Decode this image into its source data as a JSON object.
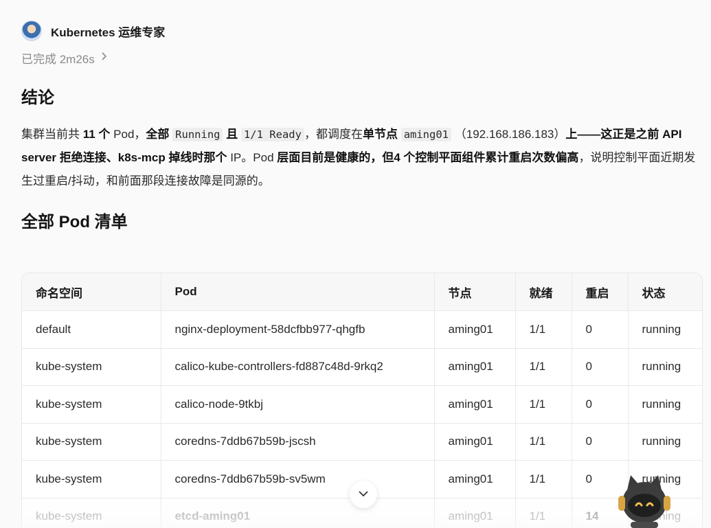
{
  "agent": {
    "name": "Kubernetes 运维专家",
    "avatar_icon": "person-avatar-icon"
  },
  "status": {
    "label": "已完成 2m26s",
    "chevron_icon": "chevron-right-icon"
  },
  "conclusion": {
    "heading": "结论",
    "p1": "集群当前共 ",
    "b1": "11 个",
    "p2": " Pod，",
    "b2": "全部",
    "c1": "Running",
    "b3": "且",
    "c2": "1/1 Ready",
    "p3": "，都调度在",
    "b4": "单节点",
    "c3": "aming01",
    "p4": "（192.168.186.183）",
    "b5": "上——这正是之前 API server 拒绝连接、k8s-mcp 掉线时那个",
    "p5": " IP。Pod ",
    "b6": "层面目前是健康的，但4 个控制平面组件累计重启次数偏高",
    "p6": "，说明控制平面近期发生过重启/抖动，和前面那段连接故障是同源的。"
  },
  "pods_section": {
    "heading": "全部 Pod 清单"
  },
  "table": {
    "headers": [
      "命名空间",
      "Pod",
      "节点",
      "就绪",
      "重启",
      "状态"
    ],
    "rows": [
      [
        "default",
        "nginx-deployment-58dcfbb977-qhgfb",
        "aming01",
        "1/1",
        "0",
        "running"
      ],
      [
        "kube-system",
        "calico-kube-controllers-fd887c48d-9rkq2",
        "aming01",
        "1/1",
        "0",
        "running"
      ],
      [
        "kube-system",
        "calico-node-9tkbj",
        "aming01",
        "1/1",
        "0",
        "running"
      ],
      [
        "kube-system",
        "coredns-7ddb67b59b-jscsh",
        "aming01",
        "1/1",
        "0",
        "running"
      ],
      [
        "kube-system",
        "coredns-7ddb67b59b-sv5wm",
        "aming01",
        "1/1",
        "0",
        "running"
      ],
      [
        "kube-system",
        "etcd-aming01",
        "aming01",
        "1/1",
        "14",
        "running"
      ]
    ]
  },
  "scroll_button": {
    "icon": "chevron-down-icon"
  },
  "assistant": {
    "icon": "robot-mascot-icon"
  }
}
